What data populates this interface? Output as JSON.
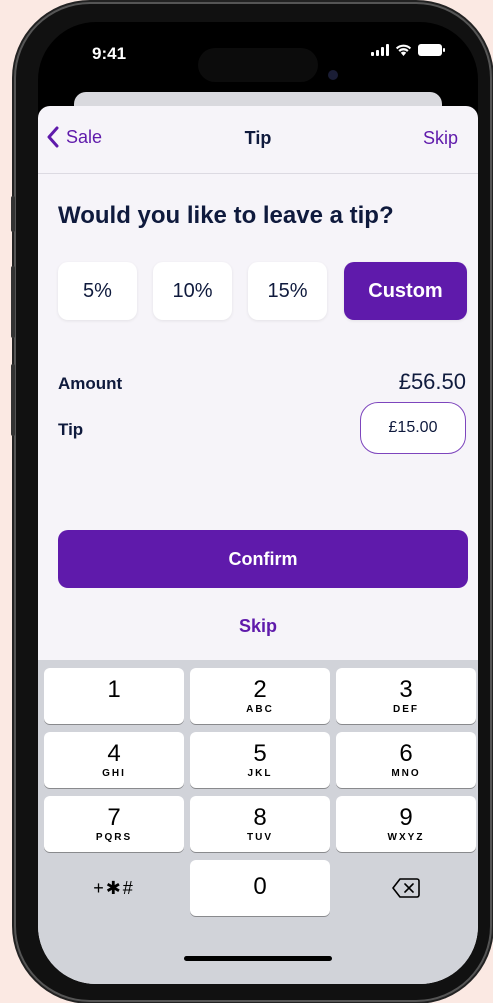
{
  "status": {
    "time": "9:41"
  },
  "navbar": {
    "back_label": "Sale",
    "title": "Tip",
    "skip_label": "Skip"
  },
  "question": "Would you like to leave a tip?",
  "tip_options": [
    {
      "label": "5%",
      "selected": false
    },
    {
      "label": "10%",
      "selected": false
    },
    {
      "label": "15%",
      "selected": false
    },
    {
      "label": "Custom",
      "selected": true
    }
  ],
  "amount": {
    "label": "Amount",
    "value": "£56.50"
  },
  "tip": {
    "label": "Tip",
    "value": "£15.00"
  },
  "confirm_label": "Confirm",
  "skip_link_label": "Skip",
  "keypad": {
    "keys": [
      {
        "digit": "1",
        "letters": ""
      },
      {
        "digit": "2",
        "letters": "ABC"
      },
      {
        "digit": "3",
        "letters": "DEF"
      },
      {
        "digit": "4",
        "letters": "GHI"
      },
      {
        "digit": "5",
        "letters": "JKL"
      },
      {
        "digit": "6",
        "letters": "MNO"
      },
      {
        "digit": "7",
        "letters": "PQRS"
      },
      {
        "digit": "8",
        "letters": "TUV"
      },
      {
        "digit": "9",
        "letters": "WXYZ"
      },
      {
        "digit": "0",
        "letters": ""
      }
    ],
    "symbols_label": "+✱#",
    "delete_icon": "delete-backspace-icon"
  },
  "colors": {
    "accent": "#5f1aab",
    "text": "#0f1a3d",
    "background": "#f6f4f9",
    "page_bg": "#fbe9e3"
  }
}
